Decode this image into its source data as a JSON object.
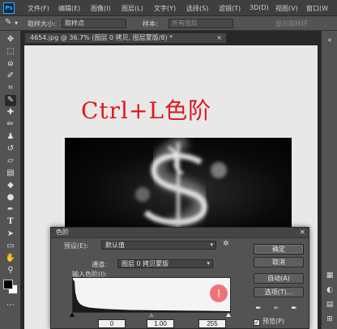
{
  "app": {
    "logo": "Ps",
    "menu": [
      "文件(F)",
      "编辑(E)",
      "图像(I)",
      "图层(L)",
      "文字(Y)",
      "选择(S)",
      "滤镜(T)",
      "3D(D)",
      "视图(V)",
      "窗口(W"
    ]
  },
  "options_bar": {
    "tool_icon": "eyedropper-icon",
    "sample_size_label": "取样大小:",
    "sample_size_value": "取样点",
    "sample_label": "样本:",
    "sample_value": "所有图层",
    "show_ring": "显示取样环"
  },
  "document": {
    "tab_title": "4654.jpg @ 36.7% (图层 0 拷贝, 图层蒙版/8) *",
    "close": "×",
    "overlay_text": "Ctrl+L色阶"
  },
  "toolbar": {
    "tools": [
      "move-icon",
      "marquee-icon",
      "lasso-icon",
      "quick-select-icon",
      "crop-icon",
      "eyedropper-icon",
      "healing-icon",
      "brush-icon",
      "clone-stamp-icon",
      "history-brush-icon",
      "eraser-icon",
      "gradient-icon",
      "blur-icon",
      "dodge-icon",
      "pen-icon",
      "type-icon",
      "path-select-icon",
      "shape-icon",
      "hand-icon",
      "zoom-icon",
      "more-icon"
    ],
    "type_tool_glyph": "T",
    "fg_color": "#000000",
    "bg_color": "#ffffff"
  },
  "levels_dialog": {
    "title": "色阶",
    "close": "×",
    "preset_label": "预设(E):",
    "preset_value": "默认值",
    "channel_label": "通道:",
    "channel_value": "图层 0 拷贝蒙版",
    "input_levels_label": "输入色阶(I):",
    "input_black": "0",
    "input_gamma": "1.00",
    "input_white": "255",
    "buttons": {
      "ok": "确定",
      "cancel": "取消",
      "auto": "自动(A)",
      "options": "选项(T)..."
    },
    "preview_label": "预览(P)",
    "preview_checked": true,
    "cursor_color": "#f05a64"
  }
}
